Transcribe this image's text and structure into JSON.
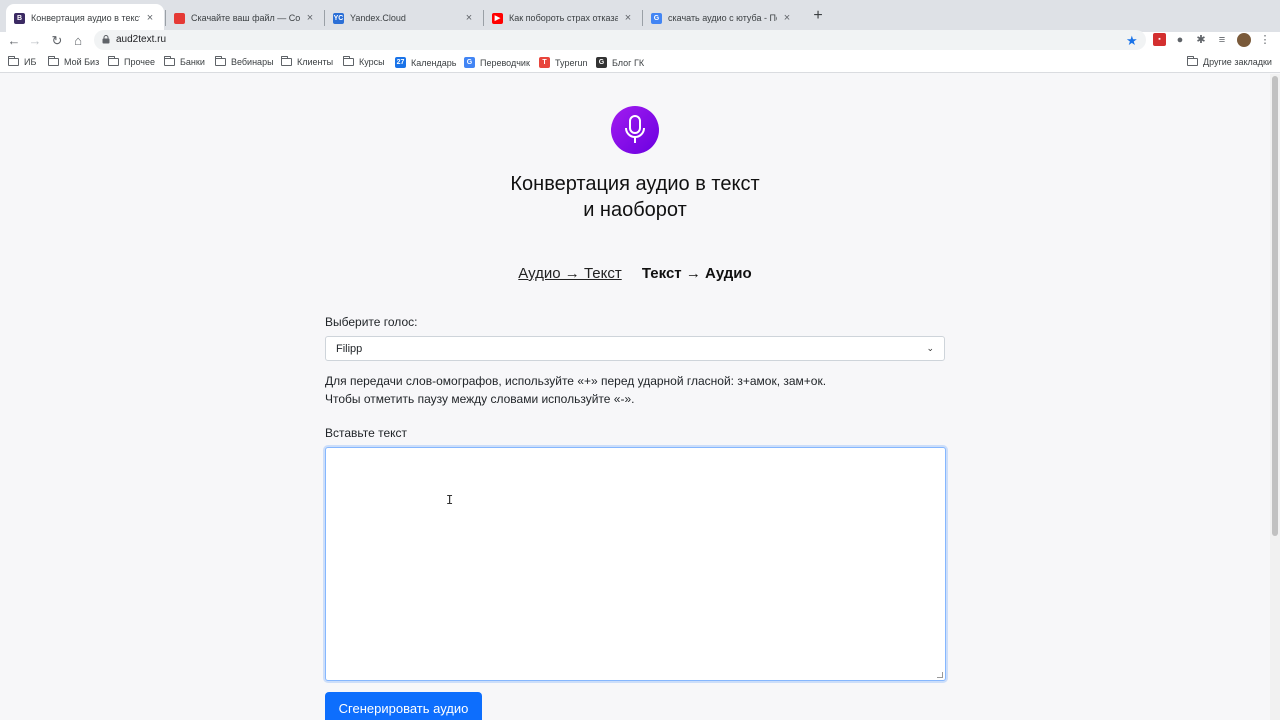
{
  "browser": {
    "tabs": [
      {
        "title": "Конвертация аудио в текст",
        "icon": "B",
        "color": "#3b2a63",
        "active": true
      },
      {
        "title": "Скачайте ваш файл — Convert",
        "icon": "",
        "color": "#e53935",
        "active": false
      },
      {
        "title": "Yandex.Cloud",
        "icon": "YC",
        "color": "#2b6fd6",
        "active": false
      },
      {
        "title": "Как побороть страх отказа п",
        "icon": "▶",
        "color": "#ff0000",
        "active": false
      },
      {
        "title": "скачать аудио с ютуба - Поис",
        "icon": "G",
        "color": "#4285f4",
        "active": false
      }
    ],
    "new_tab": "+",
    "url": "aud2text.ru",
    "bookmarks": [
      {
        "label": "ИБ",
        "type": "folder"
      },
      {
        "label": "Мой Биз",
        "type": "folder"
      },
      {
        "label": "Прочее",
        "type": "folder"
      },
      {
        "label": "Банки",
        "type": "folder"
      },
      {
        "label": "Вебинары",
        "type": "folder"
      },
      {
        "label": "Клиенты",
        "type": "folder"
      },
      {
        "label": "Курсы",
        "type": "folder"
      },
      {
        "label": "Календарь",
        "type": "icon",
        "icon": "27",
        "color": "#1a73e8"
      },
      {
        "label": "Переводчик",
        "type": "icon",
        "icon": "G",
        "color": "#4285f4"
      },
      {
        "label": "Typerun",
        "type": "icon",
        "icon": "T",
        "color": "#e8453c"
      },
      {
        "label": "Блог ГК",
        "type": "icon",
        "icon": "G",
        "color": "#333333"
      }
    ],
    "other_bookmarks": "Другие закладки"
  },
  "page": {
    "title_line1": "Конвертация аудио в текст",
    "title_line2": "и наоборот",
    "mode_audio_to_text": "Аудио → Текст",
    "mode_text_to_audio": "Текст → Аудио",
    "voice_label": "Выберите голос:",
    "voice_selected": "Filipp",
    "hint_line1": "Для передачи слов-омографов, используйте «+» перед ударной гласной: з+амок, зам+ок.",
    "hint_line2": "Чтобы отметить паузу между словами используйте «-».",
    "text_label": "Вставьте текст",
    "text_value": "",
    "generate_button": "Сгенерировать аудио"
  },
  "colors": {
    "accent": "#0d6efd",
    "logo_gradient": [
      "#a21cf0",
      "#6a00e0"
    ]
  }
}
